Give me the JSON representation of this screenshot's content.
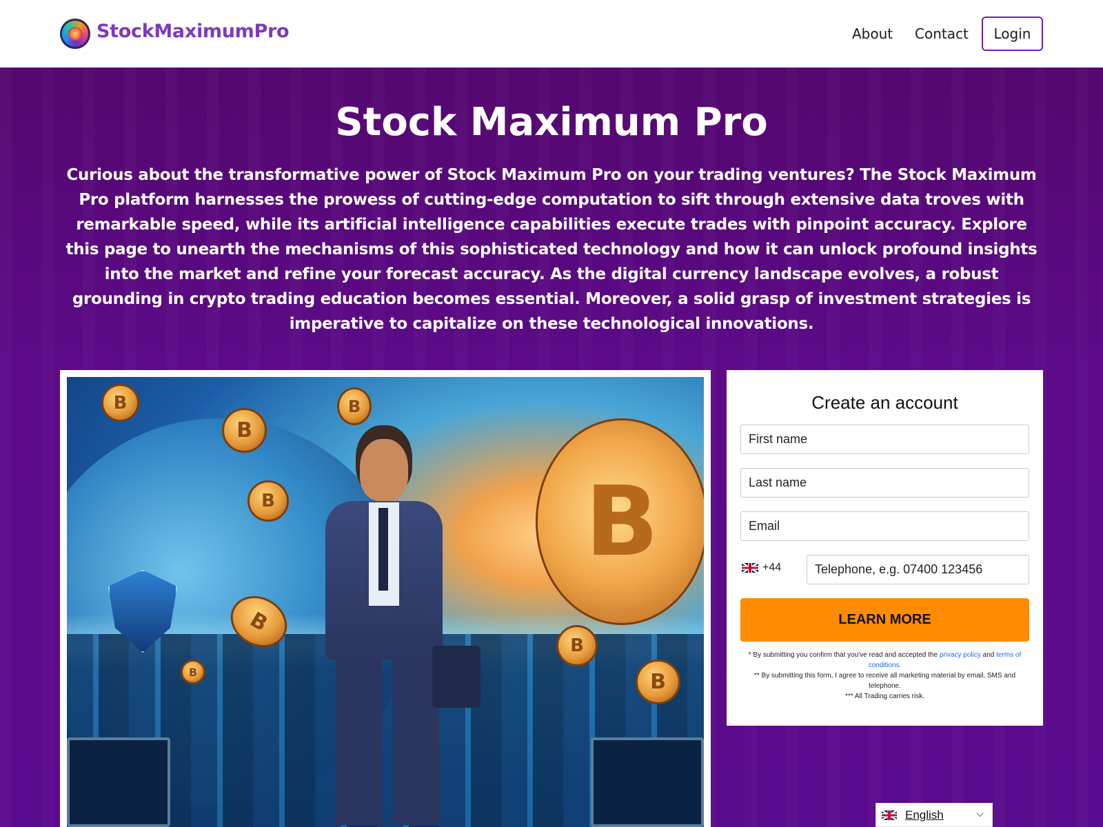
{
  "header": {
    "brand": "StockMaximumPro",
    "nav": {
      "about": "About",
      "contact": "Contact",
      "login": "Login"
    }
  },
  "hero": {
    "title": "Stock Maximum Pro",
    "text": "Curious about the transformative power of Stock Maximum Pro on your trading ventures? The Stock Maximum Pro platform harnesses the prowess of cutting-edge computation to sift through extensive data troves with remarkable speed, while its artificial intelligence capabilities execute trades with pinpoint accuracy. Explore this page to unearth the mechanisms of this sophisticated technology and how it can unlock profound insights into the market and refine your forecast accuracy. As the digital currency landscape evolves, a robust grounding in crypto trading education becomes essential. Moreover, a solid grasp of investment strategies is imperative to capitalize on these technological innovations."
  },
  "form": {
    "title": "Create an account",
    "first_name_placeholder": "First name",
    "last_name_placeholder": "Last name",
    "email_placeholder": "Email",
    "phone_code": "+44",
    "phone_arrow": "▼",
    "phone_placeholder": "Telephone, e.g.  07400 123456",
    "submit_label": "LEARN MORE",
    "disclaimer": {
      "line1_prefix": "* By submitting you confirm that you've read and accepted the ",
      "privacy_link": "privacy policy",
      "line1_and": " and ",
      "terms_link": "terms of conditions.",
      "line2": "** By submitting this form, I agree to receive all marketing material by email, SMS and telephone.",
      "line3": "*** All Trading carries risk."
    },
    "button_color": "#ff8c00"
  },
  "illustration": {
    "coin_symbol": "B"
  },
  "language": {
    "label": "English",
    "chevron": "⌵"
  },
  "colors": {
    "brand": "#7b3bbf",
    "hero_bg": "#5b0a86",
    "link": "#1d6ed8"
  }
}
